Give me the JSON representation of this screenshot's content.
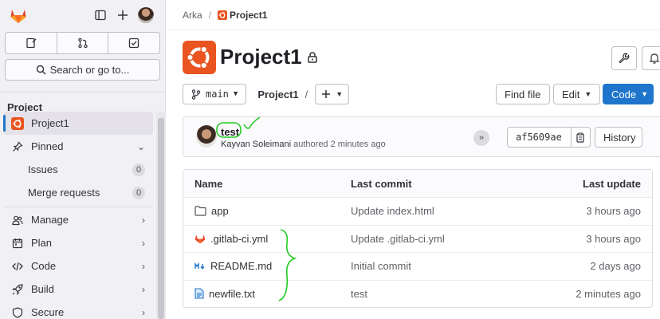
{
  "sidebar": {
    "section_title": "Project",
    "search_placeholder": "Search or go to...",
    "items": [
      {
        "label": "Project1"
      },
      {
        "label": "Pinned"
      },
      {
        "label": "Issues",
        "count": "0"
      },
      {
        "label": "Merge requests",
        "count": "0"
      },
      {
        "label": "Manage"
      },
      {
        "label": "Plan"
      },
      {
        "label": "Code"
      },
      {
        "label": "Build"
      },
      {
        "label": "Secure"
      }
    ]
  },
  "breadcrumb": {
    "group": "Arka",
    "project": "Project1"
  },
  "project": {
    "title": "Project1"
  },
  "toolbar": {
    "branch": "main",
    "path": "Project1",
    "path_sep": "/",
    "find_file": "Find file",
    "edit": "Edit",
    "code": "Code"
  },
  "commit": {
    "title": "test",
    "author": "Kayvan Soleimani",
    "meta": "authored 2 minutes ago",
    "sha": "af5609ae",
    "history": "History"
  },
  "file_table": {
    "headers": {
      "name": "Name",
      "last_commit": "Last commit",
      "last_update": "Last update"
    },
    "rows": [
      {
        "name": "app",
        "type": "folder",
        "commit": "Update index.html",
        "updated": "3 hours ago"
      },
      {
        "name": ".gitlab-ci.yml",
        "type": "gitlab",
        "commit": "Update .gitlab-ci.yml",
        "updated": "3 hours ago"
      },
      {
        "name": "README.md",
        "type": "markdown",
        "commit": "Initial commit",
        "updated": "2 days ago"
      },
      {
        "name": "newfile.txt",
        "type": "text",
        "commit": "test",
        "updated": "2 minutes ago"
      }
    ]
  },
  "colors": {
    "accent": "#1f75cb",
    "ubuntu_orange": "#e95420",
    "annotation_green": "#22cc22"
  }
}
